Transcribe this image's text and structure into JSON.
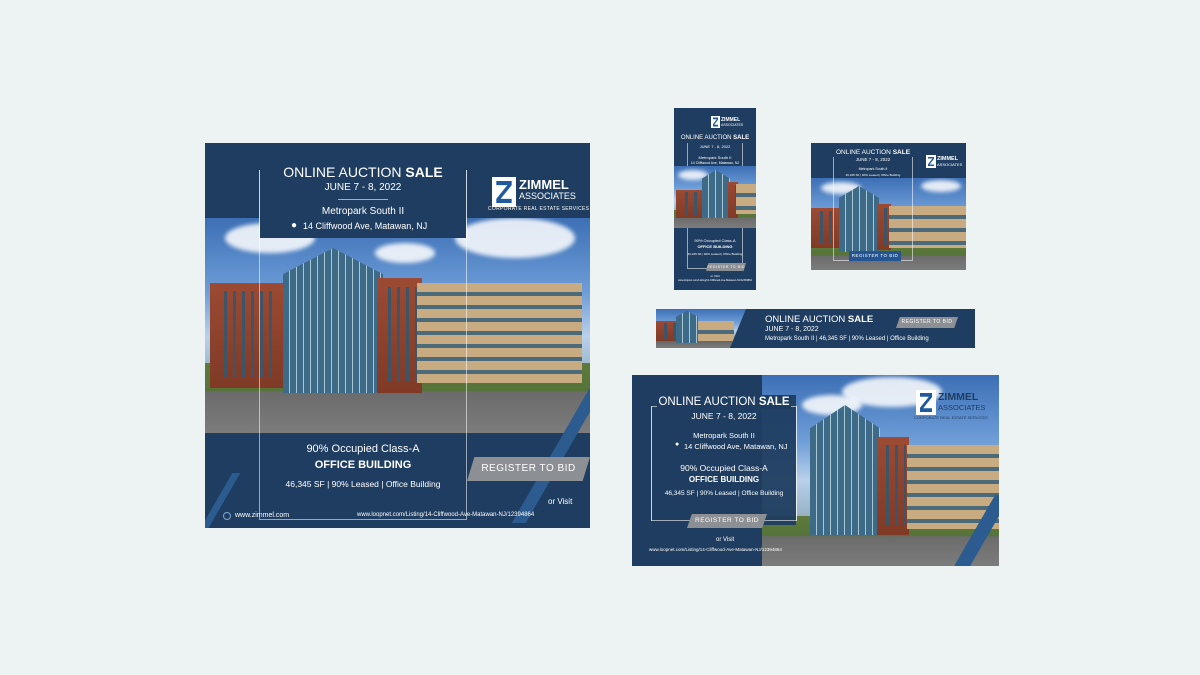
{
  "theme": {
    "navy": "#1f3d60",
    "accent_blue": "#245592",
    "button_gray": "#8c8f93",
    "background": "#edf3f3"
  },
  "icons": [
    "map-pin-icon",
    "globe-icon",
    "zimmel-logo-mark"
  ],
  "logo": {
    "name": "ZIMMEL",
    "sub": "ASSOCIATES",
    "tagline": "CORPORATE REAL ESTATE SERVICES"
  },
  "auction": {
    "title_thin": "ONLINE AUCTION",
    "title_bold": "SALE",
    "dates": "JUNE 7 - 8, 2022",
    "property": "Metropark South II",
    "address": "14 Cliffwood Ave, Matawan, NJ",
    "occupancy": "90% Occupied Class-A",
    "type_bold": "OFFICE BUILDING",
    "facts": "46,345 SF  |  90% Leased  |  Office Building",
    "cta": "REGISTER TO BID",
    "or_visit": "or Visit",
    "website": "www.zimmel.com",
    "listing_url": "www.loopnet.com/Listing/14-Cliffwood-Ave-Matawan-NJ/12394864"
  },
  "leaderboard": {
    "facts": "Metropark South II  |  46,345 SF  |  90% Leased  |  Office Building"
  }
}
